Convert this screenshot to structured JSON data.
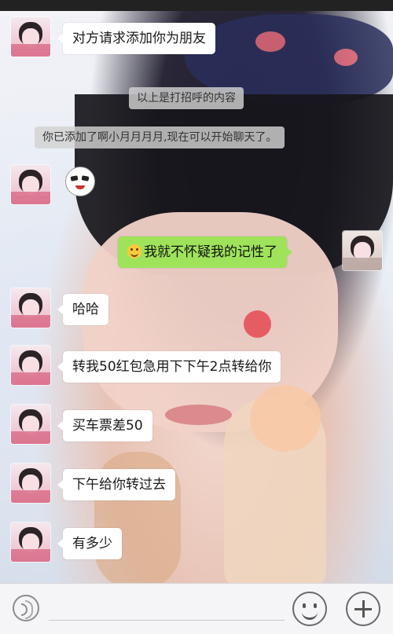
{
  "messages": {
    "m1": "对方请求添加你为朋友",
    "m2": "我就不怀疑我的记性了",
    "m3": "哈哈",
    "m4": "转我50红包急用下下午2点转给你",
    "m5": "买车票差50",
    "m6": "下午给你转过去",
    "m7": "有多少"
  },
  "system": {
    "greeting_note": "以上是打招呼的内容",
    "added_note": "你已添加了啊小月月月月,现在可以开始聊天了。"
  },
  "icons": {
    "voice": "voice-icon",
    "emoji": "emoji-icon",
    "plus": "plus-icon",
    "smiley": "smiley-icon",
    "sticker": "sticker-face-icon"
  },
  "colors": {
    "outgoing_bubble": "#9fe35a",
    "incoming_bubble": "#ffffff",
    "system_bg": "#d2d2d2"
  }
}
